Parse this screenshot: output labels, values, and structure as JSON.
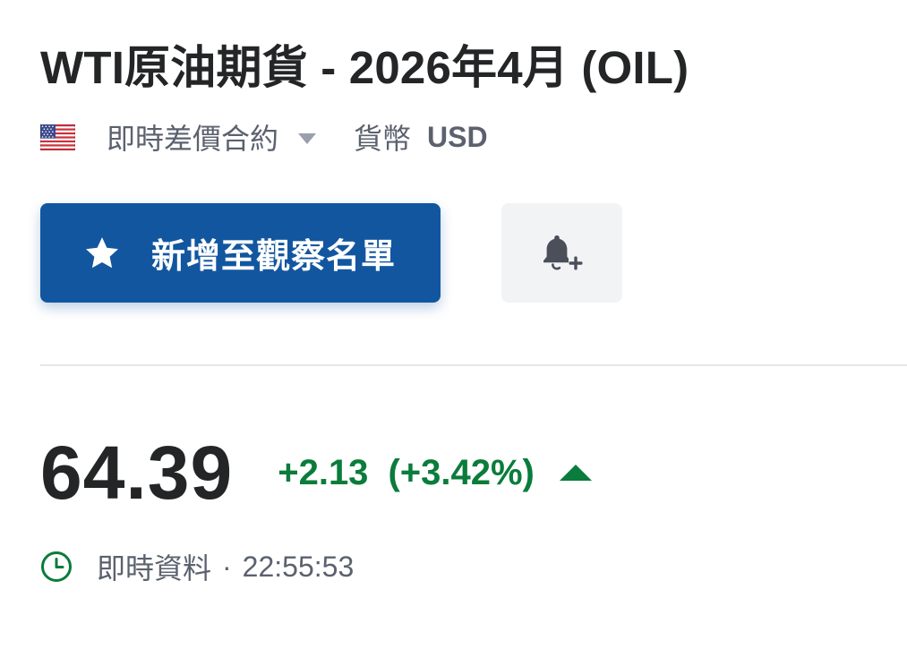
{
  "instrument": {
    "title": "WTI原油期貨 - 2026年4月 (OIL)",
    "flag_icon": "us-flag-icon",
    "contract_type": "即時差價合約",
    "currency_label": "貨幣",
    "currency_value": "USD"
  },
  "actions": {
    "watchlist_label": "新增至觀察名單",
    "watchlist_icon": "star-icon",
    "alert_icon": "bell-plus-icon",
    "primary_color": "#1256a0"
  },
  "quote": {
    "price": "64.39",
    "change": "+2.13",
    "change_percent": "(+3.42%)",
    "direction": "up",
    "positive_color": "#0a7c3b"
  },
  "status": {
    "icon": "clock-icon",
    "label": "即時資料",
    "separator": "·",
    "time": "22:55:53"
  }
}
